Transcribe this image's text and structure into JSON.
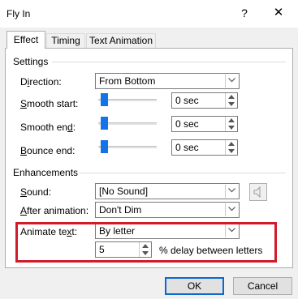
{
  "window": {
    "title": "Fly In",
    "help": "?",
    "close": "✕"
  },
  "tabs": [
    {
      "label": "Effect",
      "active": true
    },
    {
      "label": "Timing",
      "active": false
    },
    {
      "label": "Text Animation",
      "active": false
    }
  ],
  "settings": {
    "group_label": "Settings",
    "direction": {
      "label": "Direction:",
      "value": "From Bottom"
    },
    "smooth_start": {
      "label": "Smooth start:",
      "value": "0 sec"
    },
    "smooth_end": {
      "label": "Smooth end:",
      "value": "0 sec"
    },
    "bounce_end": {
      "label": "Bounce end:",
      "value": "0 sec"
    }
  },
  "enhancements": {
    "group_label": "Enhancements",
    "sound": {
      "label": "Sound:",
      "value": "[No Sound]"
    },
    "after_animation": {
      "label": "After animation:",
      "value": "Don't Dim"
    },
    "animate_text": {
      "label": "Animate text:",
      "value": "By letter"
    },
    "delay": {
      "value": "5",
      "suffix": "% delay between letters"
    }
  },
  "buttons": {
    "ok": "OK",
    "cancel": "Cancel"
  },
  "colors": {
    "highlight": "#d11b2a",
    "slider_thumb": "#1473e6",
    "ok_border": "#0a68cf"
  },
  "icons": {
    "sound": "speaker-icon"
  }
}
